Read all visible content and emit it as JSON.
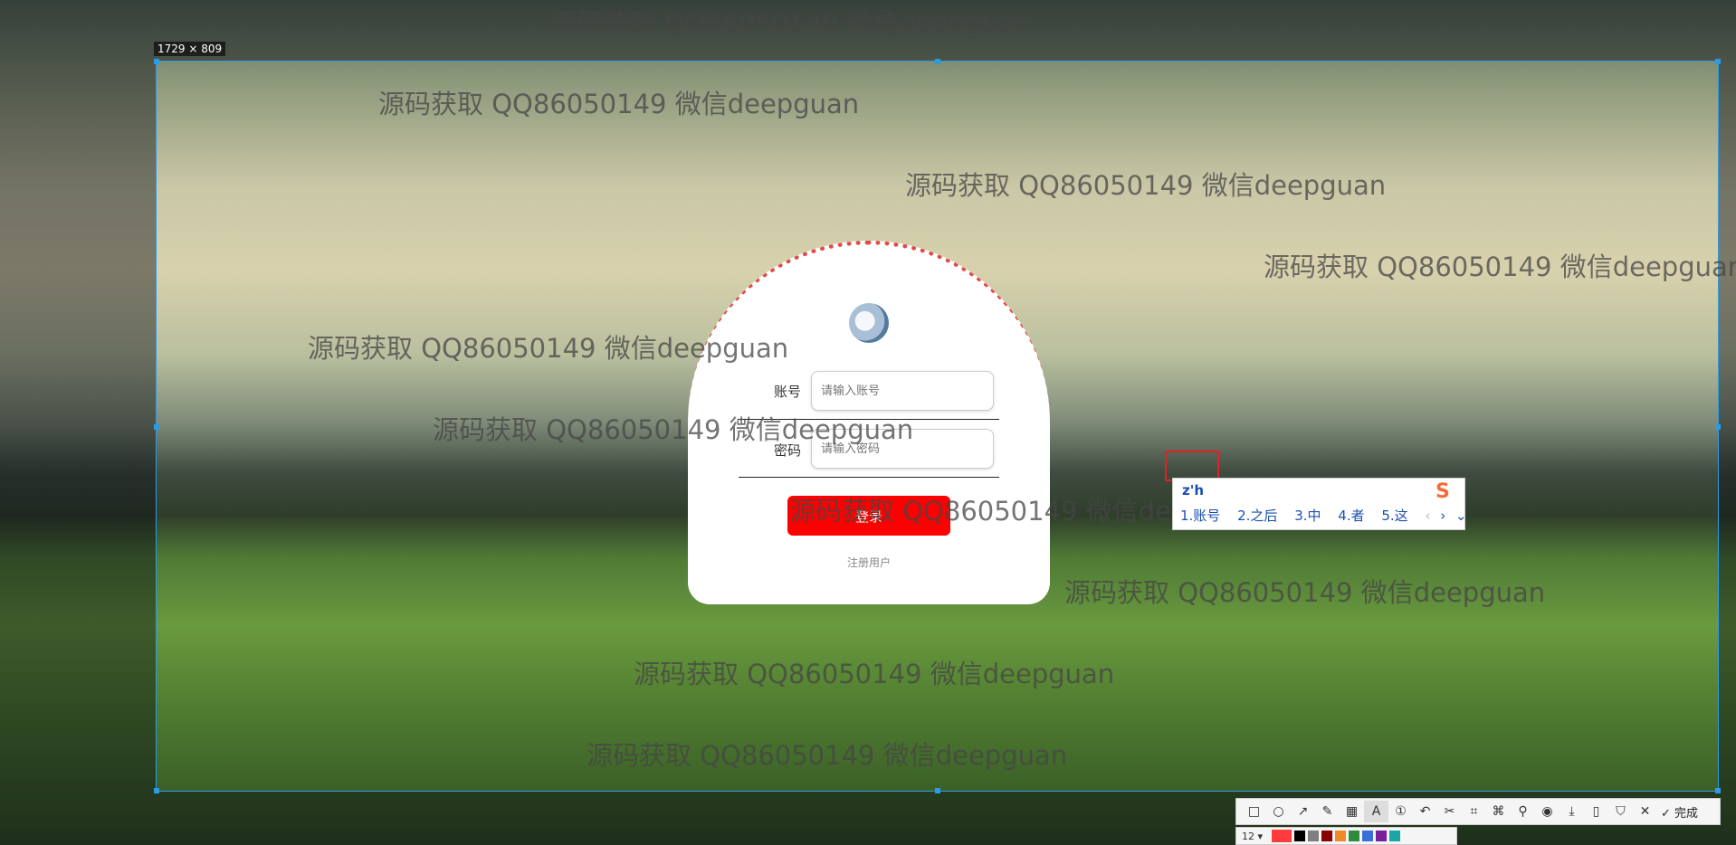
{
  "screenshot_tool": {
    "size_badge": "1729 × 809",
    "toolbar": {
      "icons": [
        "rectangle-icon",
        "ellipse-icon",
        "arrow-icon",
        "pen-icon",
        "mosaic-icon",
        "text-icon",
        "number-icon",
        "undo-icon",
        "scissors-icon",
        "ocr-icon",
        "crop-icon",
        "pin-icon",
        "record-icon",
        "save-icon",
        "long-screenshot-icon",
        "bookmark-icon",
        "close-icon"
      ],
      "done_label": "完成"
    },
    "font_size": "12",
    "swatches": [
      "#ff3b3b",
      "#000000",
      "#7f7f7f",
      "#8b0000",
      "#f08a24",
      "#2e8b3a",
      "#3a6fd8",
      "#7a1f9c",
      "#1aa6a6"
    ]
  },
  "watermark_text": "源码获取 QQ86050149 微信deepguan",
  "login": {
    "account_label": "账号",
    "account_placeholder": "请输入账号",
    "password_label": "密码",
    "password_placeholder": "请输入密码",
    "login_button": "登录",
    "register_link": "注册用户"
  },
  "ime": {
    "composition": "z'h",
    "candidates": [
      "1.账号",
      "2.之后",
      "3.中",
      "4.者",
      "5.这"
    ]
  },
  "colors": {
    "login_button": "#ff0000",
    "selection_border": "#2b9be6",
    "card_dots": "#e14a4a"
  }
}
